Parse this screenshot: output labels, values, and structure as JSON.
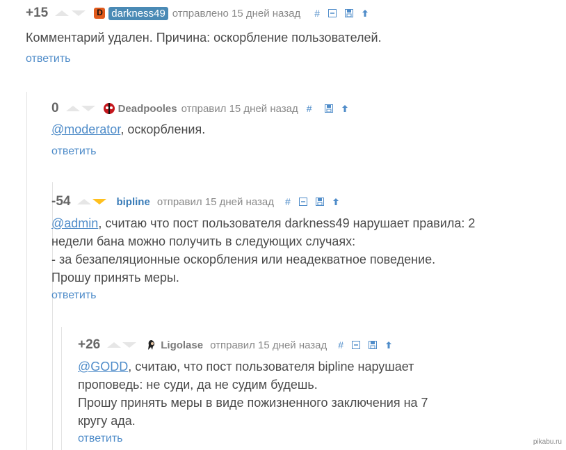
{
  "comments": [
    {
      "rating": "+15",
      "username": "darkness49",
      "meta": "отправлено 15 дней назад",
      "text": "Комментарий удален. Причина: оскорбление пользователей.",
      "reply": "ответить"
    },
    {
      "rating": "0",
      "username": "Deadpooles",
      "meta": "отправил 15 дней назад",
      "mention": "@moderator",
      "text": ", оскорбления.",
      "reply": "ответить"
    },
    {
      "rating": "-54",
      "username": "bipline",
      "meta": "отправил 15 дней назад",
      "mention": "@admin",
      "text_line1": ", считаю что пост пользователя darkness49 нарушает правила: 2",
      "text_line2": "недели бана можно получить в следующих случаях:",
      "text_line3": "- за безапеляционные оскорбления или неадекватное поведение.",
      "text_line4": "Прошу принять меры.",
      "reply": "ответить"
    },
    {
      "rating": "+26",
      "username": "Ligolase",
      "meta": "отправил 15 дней назад",
      "mention": "@GODD",
      "text_line1": ", считаю, что пост пользователя bipline нарушает",
      "text_line2": "проповедь: не суди, да не судим будешь.",
      "text_line3": "Прошу принять меры в виде пожизненного заключения на 7",
      "text_line4": "кругу ада.",
      "reply": "ответить"
    }
  ],
  "toolbar": {
    "hash": "#",
    "icons": [
      "collapse-icon",
      "save-icon",
      "parent-arrow-icon"
    ]
  },
  "watermark": "pikabu.ru",
  "colors": {
    "accent": "#4f8cc9",
    "vote_down_active": "#ffc01e",
    "username_tag_bg": "#4a8ab5",
    "username_blue": "#3a7cb8"
  }
}
